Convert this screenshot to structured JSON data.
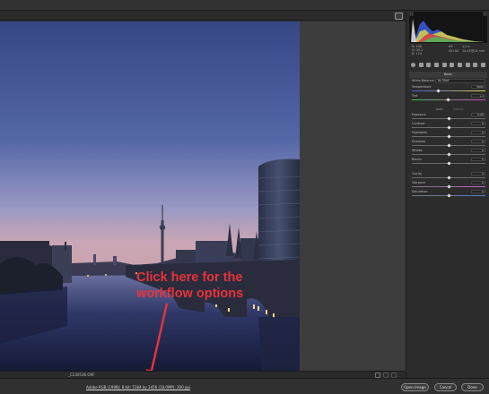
{
  "file": {
    "name": "_C230536.ORF"
  },
  "workflow": {
    "label": "Adobe RGB (1998); 8 bit; 5184 by 3456 (18.0MP); 300 ppi"
  },
  "buttons": {
    "open_image": "Open Image",
    "cancel": "Cancel",
    "done": "Done"
  },
  "annotation": {
    "line1": "Click here for the",
    "line2": "workflow options"
  },
  "readouts": {
    "r_label": "R:",
    "g_label": "G:",
    "b_label": "B:",
    "r": "108",
    "g": "26.1",
    "b": "124",
    "aperture": "f/5",
    "shutter": "1,0 s",
    "iso": "ISO 64",
    "lens": "14-42@14 mm"
  },
  "panel": {
    "section_title": "Basic",
    "white_balance_label": "White Balance:",
    "white_balance_value": "As Shot",
    "temperature_label": "Temperature",
    "temperature_value": "5600",
    "tint_label": "Tint",
    "tint_value": "+1",
    "auto_label": "Auto",
    "default_label": "Default",
    "exposure_label": "Exposure",
    "exposure_value": "0,00",
    "contrast_label": "Contrast",
    "contrast_value": "0",
    "highlights_label": "Highlights",
    "highlights_value": "0",
    "shadows_label": "Shadows",
    "shadows_value": "0",
    "whites_label": "Whites",
    "whites_value": "0",
    "blacks_label": "Blacks",
    "blacks_value": "0",
    "clarity_label": "Clarity",
    "clarity_value": "0",
    "vibrance_label": "Vibrance",
    "vibrance_value": "0",
    "saturation_label": "Saturation",
    "saturation_value": "0"
  },
  "colors": {
    "annotation": "#e8333a",
    "sky_top": "#3b4a8c",
    "sky_bottom": "#c9a3b2",
    "panel_bg": "#2c2c2c"
  }
}
